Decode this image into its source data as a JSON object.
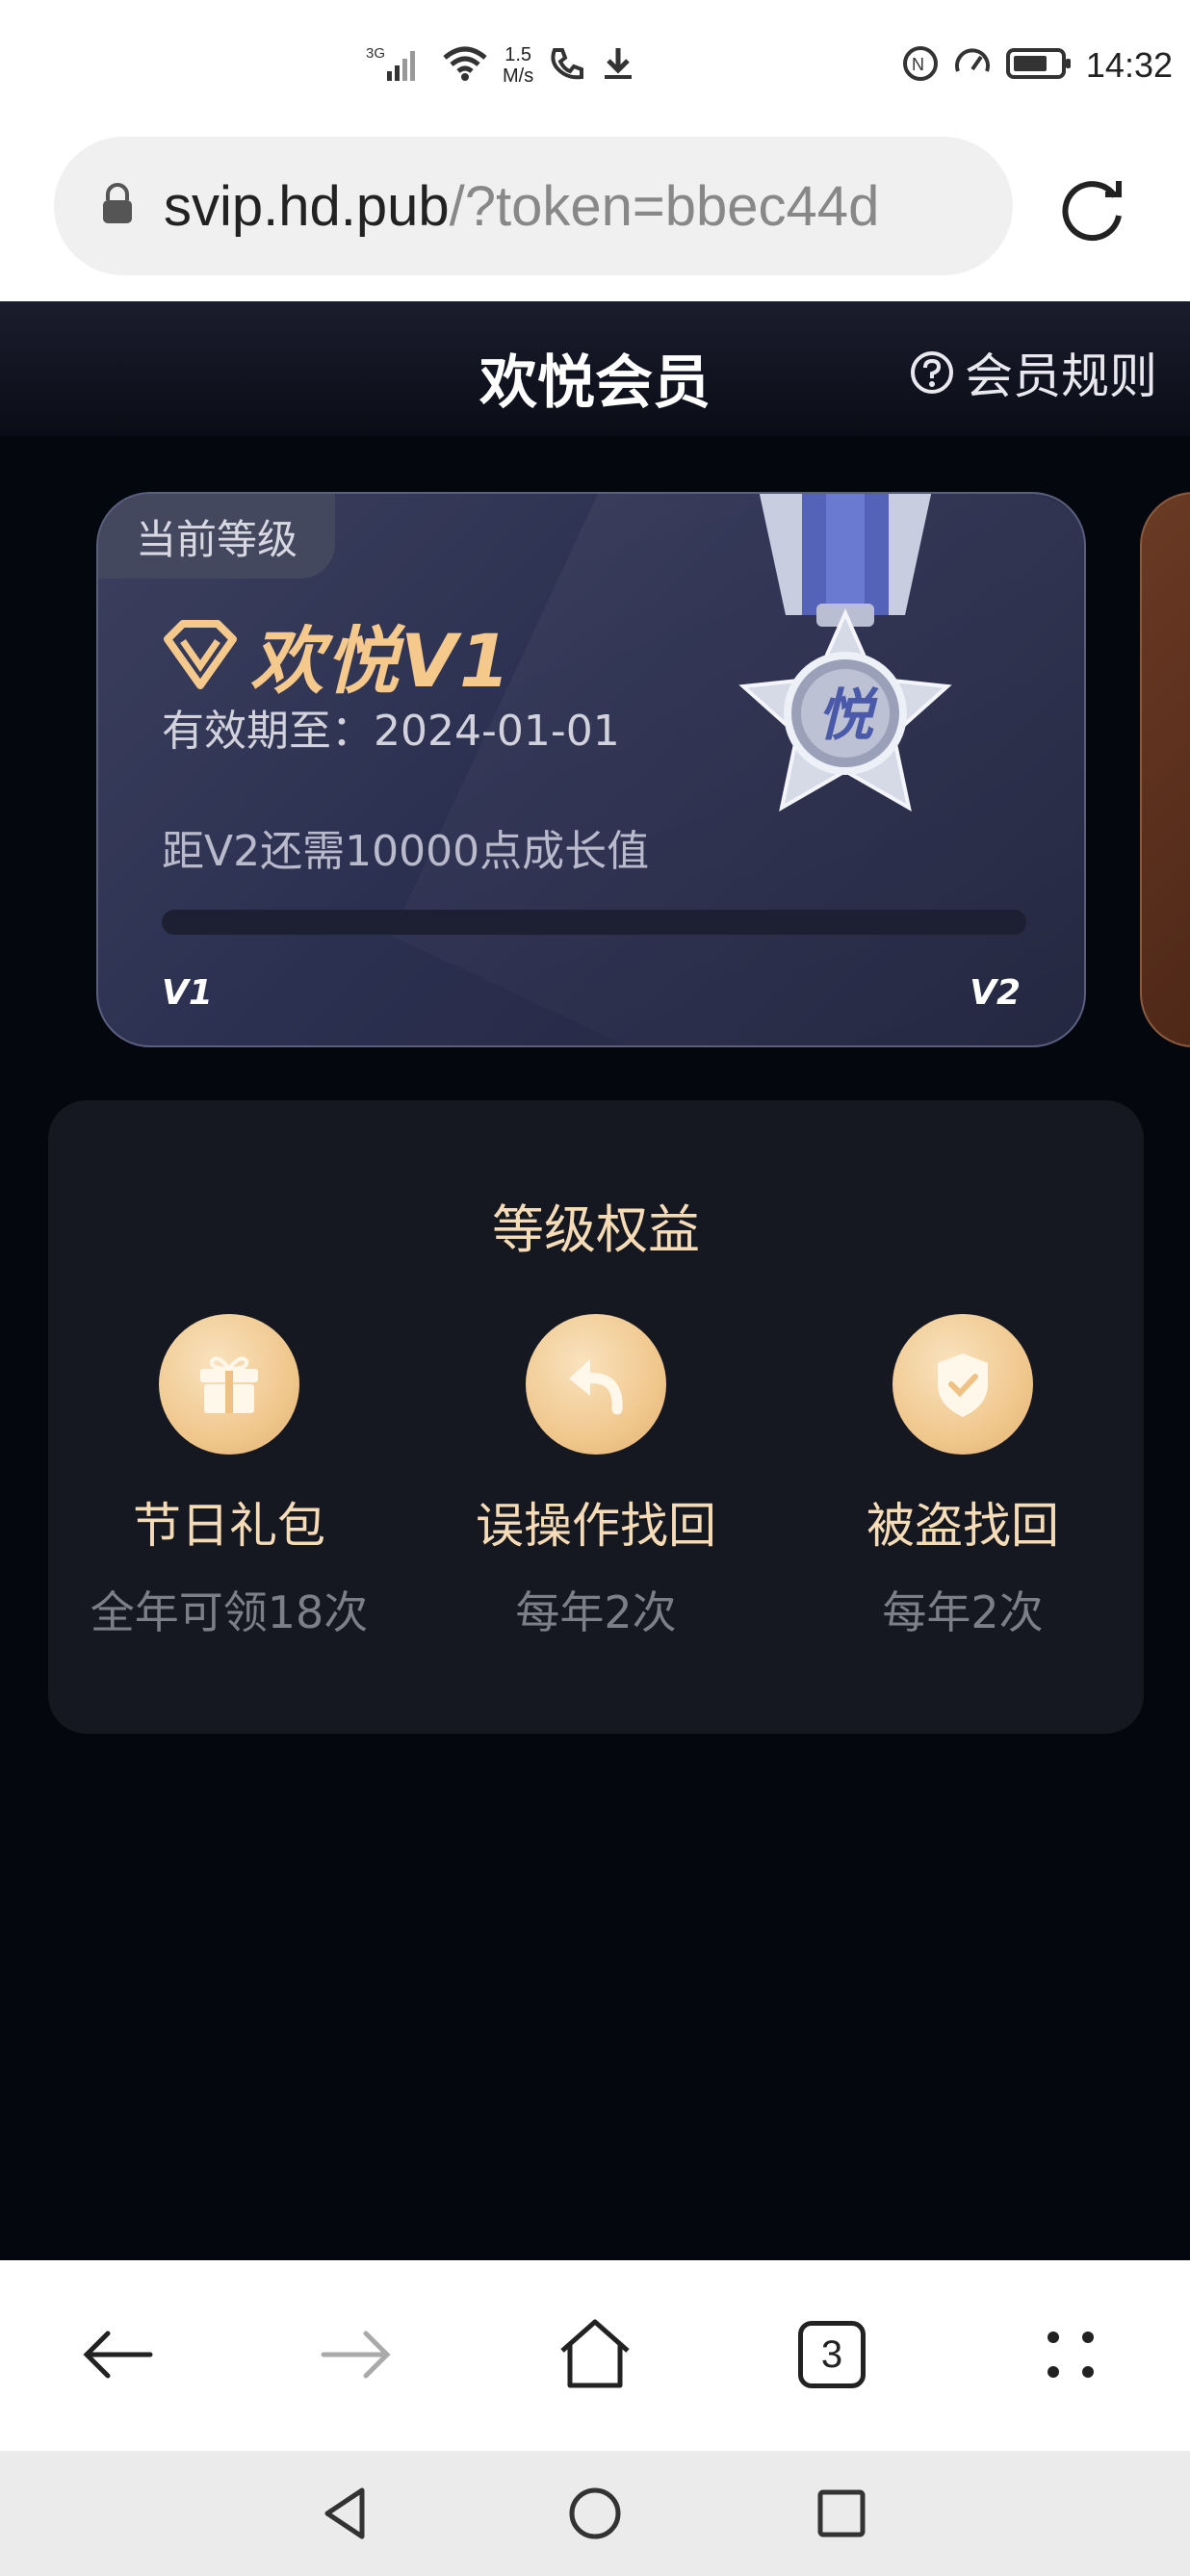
{
  "status_bar": {
    "network": "3G",
    "speed_value": "1.5",
    "speed_unit": "M/s",
    "time": "14:32",
    "icons": [
      "signal-icon",
      "wifi-icon",
      "call-icon",
      "download-icon",
      "nfc-icon",
      "speed-icon",
      "battery-icon"
    ]
  },
  "address_bar": {
    "url_host": "svip.hd.pub",
    "url_path": "/?token=bbec44d"
  },
  "header": {
    "title": "欢悦会员",
    "rules_label": "会员规则"
  },
  "level_card": {
    "tag": "当前等级",
    "level_name": "欢悦V1",
    "validity": "有效期至：2024-01-01",
    "need_text": "距V2还需10000点成长值",
    "progress": 0,
    "from_level": "V1",
    "to_level": "V2",
    "medal_char": "悦"
  },
  "benefits": {
    "title": "等级权益",
    "items": [
      {
        "icon": "gift-icon",
        "title": "节日礼包",
        "subtitle": "全年可领18次"
      },
      {
        "icon": "undo-icon",
        "title": "误操作找回",
        "subtitle": "每年2次"
      },
      {
        "icon": "shield-icon",
        "title": "被盗找回",
        "subtitle": "每年2次"
      }
    ]
  },
  "bottom_bar": {
    "tab_count": "3"
  },
  "colors": {
    "page_bg": "#05070f",
    "gold": "#f6dcb6",
    "card": "#2c3050",
    "benefit_panel": "#151821"
  }
}
